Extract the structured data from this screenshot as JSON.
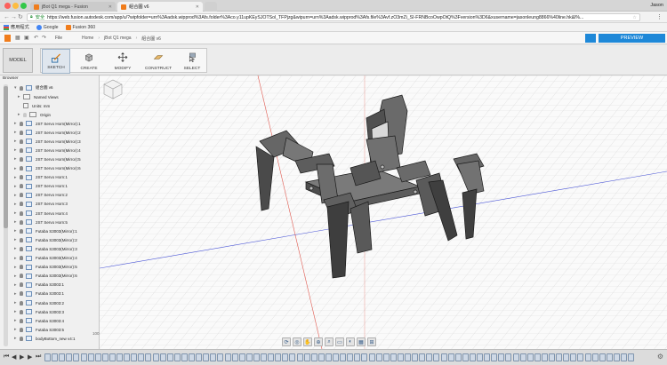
{
  "browser_window": {
    "tabs": [
      {
        "title": "jBot Q1 mega - Fusion",
        "active": false
      },
      {
        "title": "組合圖 v6",
        "active": true
      }
    ],
    "user": "Jason",
    "address": {
      "secure_label": "安全",
      "url": "https://web.fusion.autodesk.com/app/u/?wipfolder=urn%3Aadsk.wipprod%3Afs.folder%3Aco.y11upKEySJOTSol_TFPjzg&wipurn=urn%3Aadsk.wipprod%3Afs.file%3Avf.zO3mZi_SI-FRNBcoOwpOtQ%3Fversion%3D6&xusername=jasonleung8866%40line.hk&l%..."
    },
    "bookmarks": [
      {
        "label": "應用程式",
        "icon": "apps-grid-icon"
      },
      {
        "label": "Google",
        "icon": "google-icon"
      },
      {
        "label": "Fusion 360",
        "icon": "fusion-icon"
      }
    ]
  },
  "app_bar": {
    "file_label": "File",
    "breadcrumbs": [
      "Home",
      "jBot Q1 mega",
      "組合圖 v6"
    ],
    "preview_label": "PREVIEW"
  },
  "toolbar": {
    "workspace": "MODEL",
    "tools": [
      {
        "label": "SKETCH",
        "icon": "sketch-icon",
        "selected": true
      },
      {
        "label": "CREATE",
        "icon": "create-box-icon",
        "selected": false
      },
      {
        "label": "MODIFY",
        "icon": "move-arrows-icon",
        "selected": false
      },
      {
        "label": "CONSTRUCT",
        "icon": "construct-plane-icon",
        "selected": false
      },
      {
        "label": "SELECT",
        "icon": "select-cursor-icon",
        "selected": false
      }
    ]
  },
  "browser_panel": {
    "header": "Browser",
    "root": "組合圖 v6",
    "named_views": "Named Views",
    "units": "Units: mm",
    "origin": "Origin",
    "components": [
      "2ST Servo Horn(Mirror):1",
      "2ST Servo Horn(Mirror):2",
      "2ST Servo Horn(Mirror):3",
      "2ST Servo Horn(Mirror):4",
      "2ST Servo Horn(Mirror):5",
      "2ST Servo Horn(Mirror):6",
      "2ST Servo Horn:1",
      "2ST Servo Horn:1",
      "2ST Servo Horn:2",
      "2ST Servo Horn:3",
      "2ST Servo Horn:4",
      "2ST Servo Horn:5",
      "Futaba S3003(Mirror):1",
      "Futaba S3003(Mirror):2",
      "Futaba S3003(Mirror):3",
      "Futaba S3003(Mirror):4",
      "Futaba S3003(Mirror):5",
      "Futaba S3003(Mirror):6",
      "Futaba S3003:1",
      "Futaba S3003:1",
      "Futaba S3003:2",
      "Futaba S3003:3",
      "Futaba S3003:4",
      "Futaba S3003:5",
      "bodyBottom_new v4:1"
    ]
  },
  "viewport": {
    "scale_label": "100",
    "viewcube_icon": "viewcube-icon",
    "nav_tools": [
      "orbit-icon",
      "look-at-icon",
      "pan-hand-icon",
      "zoom-icon",
      "zoom-window-icon",
      "display-mode-icon",
      "visual-style-icon",
      "grid-icon",
      "viewports-icon"
    ]
  },
  "timeline": {
    "controls": [
      "first-icon",
      "previous-icon",
      "play-icon",
      "next-icon",
      "last-icon"
    ],
    "feature_count": 82
  },
  "colors": {
    "preview_blue": "#1e88d8",
    "fusion_orange": "#f07c1b",
    "axis_red": "#e0594f",
    "axis_blue": "#4b56d6",
    "model_body": "#5a5a5a"
  }
}
